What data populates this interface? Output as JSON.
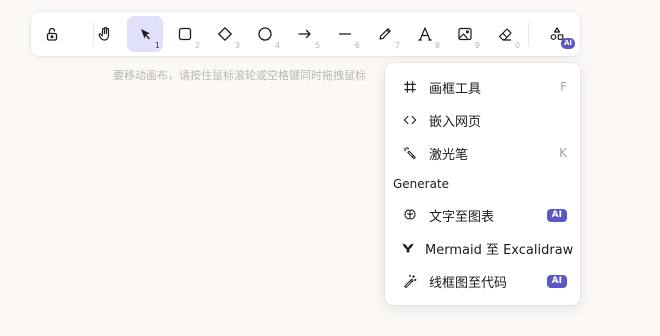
{
  "toolbar": {
    "tools": [
      {
        "name": "lock",
        "key": ""
      },
      {
        "name": "hand",
        "key": ""
      },
      {
        "name": "selection",
        "key": "1"
      },
      {
        "name": "rectangle",
        "key": "2"
      },
      {
        "name": "diamond",
        "key": "3"
      },
      {
        "name": "ellipse",
        "key": "4"
      },
      {
        "name": "arrow",
        "key": "5"
      },
      {
        "name": "line",
        "key": "6"
      },
      {
        "name": "draw",
        "key": "7"
      },
      {
        "name": "text",
        "key": "8"
      },
      {
        "name": "image",
        "key": "9"
      },
      {
        "name": "eraser",
        "key": "0"
      }
    ],
    "active_tool": "selection",
    "more_tools_badge": "AI",
    "accent_color": "#e1e0fb",
    "badge_color": "#5b57c9"
  },
  "hint": {
    "text": "要移动画布，请按住鼠标滚轮或空格键同时拖拽鼠标"
  },
  "more_tools_menu": {
    "items": [
      {
        "label": "画框工具",
        "shortcut": "F",
        "icon": "frame-icon"
      },
      {
        "label": "嵌入网页",
        "shortcut": "",
        "icon": "embed-code-icon"
      },
      {
        "label": "激光笔",
        "shortcut": "K",
        "icon": "laser-pointer-icon"
      }
    ],
    "generate_section": {
      "title": "Generate",
      "items": [
        {
          "label": "文字至图表",
          "badge": "AI",
          "icon": "brain-icon"
        },
        {
          "label": "Mermaid 至 Excalidraw",
          "badge": "",
          "icon": "mermaid-icon"
        },
        {
          "label": "线框图至代码",
          "badge": "AI",
          "icon": "magic-wand-icon"
        }
      ]
    }
  }
}
